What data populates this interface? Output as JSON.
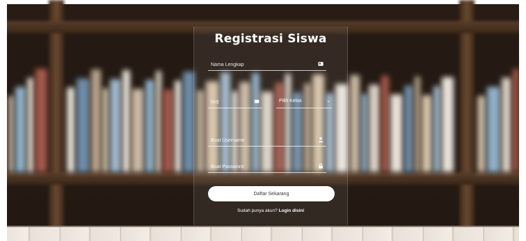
{
  "form": {
    "title": "Registrasi Siswa",
    "full_name_placeholder": "Nama Lengkap",
    "nis_placeholder": "NIS",
    "class_selected": "Pilih Kelas",
    "username_placeholder": "Buat Username",
    "password_placeholder": "Buat Password",
    "submit_label": "Daftar Sekarang",
    "login_prompt": "Sudah punya akun?",
    "login_link": "Login disini"
  },
  "icons": {
    "full_name": "id-card-icon",
    "nis": "badge-icon",
    "class": "chevron-down-icon",
    "username": "user-icon",
    "password": "lock-icon"
  },
  "colors": {
    "text": "#ffffff",
    "button_bg": "#ffffff",
    "button_text": "#333333"
  }
}
